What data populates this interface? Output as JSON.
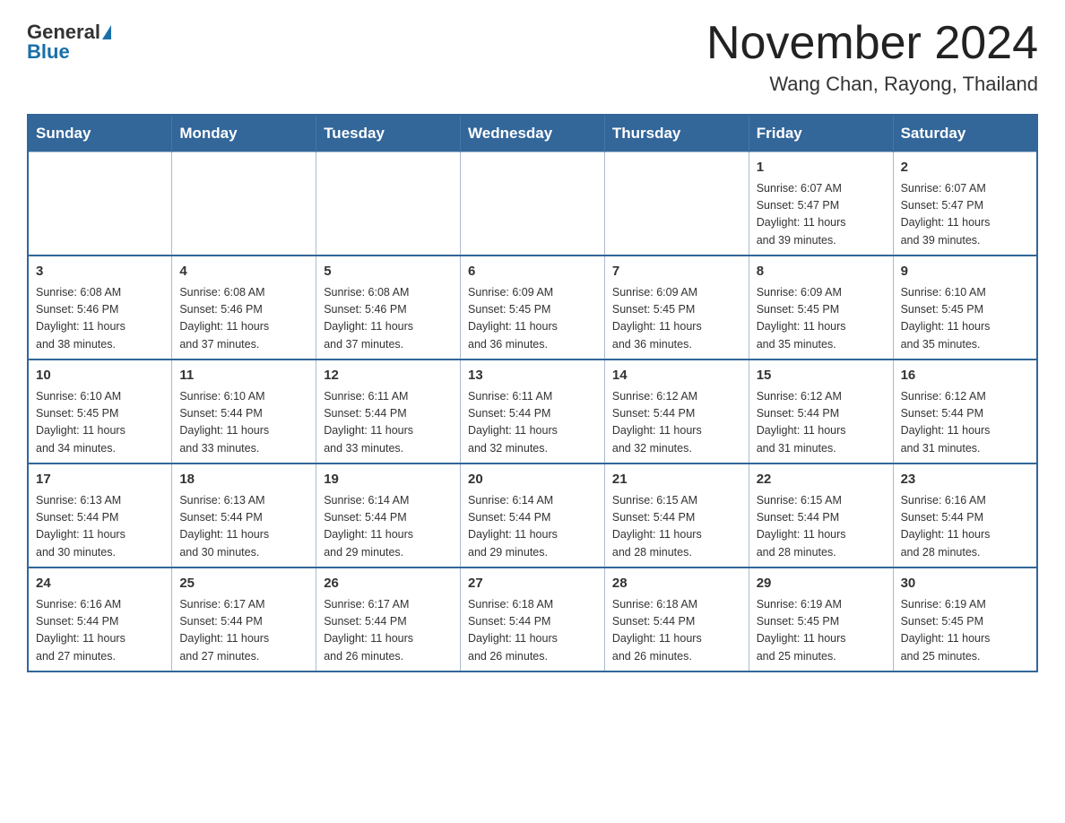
{
  "logo": {
    "general": "General",
    "blue": "Blue",
    "triangle": "▶"
  },
  "title": {
    "month_year": "November 2024",
    "location": "Wang Chan, Rayong, Thailand"
  },
  "calendar": {
    "headers": [
      "Sunday",
      "Monday",
      "Tuesday",
      "Wednesday",
      "Thursday",
      "Friday",
      "Saturday"
    ],
    "weeks": [
      [
        {
          "day": "",
          "info": ""
        },
        {
          "day": "",
          "info": ""
        },
        {
          "day": "",
          "info": ""
        },
        {
          "day": "",
          "info": ""
        },
        {
          "day": "",
          "info": ""
        },
        {
          "day": "1",
          "info": "Sunrise: 6:07 AM\nSunset: 5:47 PM\nDaylight: 11 hours\nand 39 minutes."
        },
        {
          "day": "2",
          "info": "Sunrise: 6:07 AM\nSunset: 5:47 PM\nDaylight: 11 hours\nand 39 minutes."
        }
      ],
      [
        {
          "day": "3",
          "info": "Sunrise: 6:08 AM\nSunset: 5:46 PM\nDaylight: 11 hours\nand 38 minutes."
        },
        {
          "day": "4",
          "info": "Sunrise: 6:08 AM\nSunset: 5:46 PM\nDaylight: 11 hours\nand 37 minutes."
        },
        {
          "day": "5",
          "info": "Sunrise: 6:08 AM\nSunset: 5:46 PM\nDaylight: 11 hours\nand 37 minutes."
        },
        {
          "day": "6",
          "info": "Sunrise: 6:09 AM\nSunset: 5:45 PM\nDaylight: 11 hours\nand 36 minutes."
        },
        {
          "day": "7",
          "info": "Sunrise: 6:09 AM\nSunset: 5:45 PM\nDaylight: 11 hours\nand 36 minutes."
        },
        {
          "day": "8",
          "info": "Sunrise: 6:09 AM\nSunset: 5:45 PM\nDaylight: 11 hours\nand 35 minutes."
        },
        {
          "day": "9",
          "info": "Sunrise: 6:10 AM\nSunset: 5:45 PM\nDaylight: 11 hours\nand 35 minutes."
        }
      ],
      [
        {
          "day": "10",
          "info": "Sunrise: 6:10 AM\nSunset: 5:45 PM\nDaylight: 11 hours\nand 34 minutes."
        },
        {
          "day": "11",
          "info": "Sunrise: 6:10 AM\nSunset: 5:44 PM\nDaylight: 11 hours\nand 33 minutes."
        },
        {
          "day": "12",
          "info": "Sunrise: 6:11 AM\nSunset: 5:44 PM\nDaylight: 11 hours\nand 33 minutes."
        },
        {
          "day": "13",
          "info": "Sunrise: 6:11 AM\nSunset: 5:44 PM\nDaylight: 11 hours\nand 32 minutes."
        },
        {
          "day": "14",
          "info": "Sunrise: 6:12 AM\nSunset: 5:44 PM\nDaylight: 11 hours\nand 32 minutes."
        },
        {
          "day": "15",
          "info": "Sunrise: 6:12 AM\nSunset: 5:44 PM\nDaylight: 11 hours\nand 31 minutes."
        },
        {
          "day": "16",
          "info": "Sunrise: 6:12 AM\nSunset: 5:44 PM\nDaylight: 11 hours\nand 31 minutes."
        }
      ],
      [
        {
          "day": "17",
          "info": "Sunrise: 6:13 AM\nSunset: 5:44 PM\nDaylight: 11 hours\nand 30 minutes."
        },
        {
          "day": "18",
          "info": "Sunrise: 6:13 AM\nSunset: 5:44 PM\nDaylight: 11 hours\nand 30 minutes."
        },
        {
          "day": "19",
          "info": "Sunrise: 6:14 AM\nSunset: 5:44 PM\nDaylight: 11 hours\nand 29 minutes."
        },
        {
          "day": "20",
          "info": "Sunrise: 6:14 AM\nSunset: 5:44 PM\nDaylight: 11 hours\nand 29 minutes."
        },
        {
          "day": "21",
          "info": "Sunrise: 6:15 AM\nSunset: 5:44 PM\nDaylight: 11 hours\nand 28 minutes."
        },
        {
          "day": "22",
          "info": "Sunrise: 6:15 AM\nSunset: 5:44 PM\nDaylight: 11 hours\nand 28 minutes."
        },
        {
          "day": "23",
          "info": "Sunrise: 6:16 AM\nSunset: 5:44 PM\nDaylight: 11 hours\nand 28 minutes."
        }
      ],
      [
        {
          "day": "24",
          "info": "Sunrise: 6:16 AM\nSunset: 5:44 PM\nDaylight: 11 hours\nand 27 minutes."
        },
        {
          "day": "25",
          "info": "Sunrise: 6:17 AM\nSunset: 5:44 PM\nDaylight: 11 hours\nand 27 minutes."
        },
        {
          "day": "26",
          "info": "Sunrise: 6:17 AM\nSunset: 5:44 PM\nDaylight: 11 hours\nand 26 minutes."
        },
        {
          "day": "27",
          "info": "Sunrise: 6:18 AM\nSunset: 5:44 PM\nDaylight: 11 hours\nand 26 minutes."
        },
        {
          "day": "28",
          "info": "Sunrise: 6:18 AM\nSunset: 5:44 PM\nDaylight: 11 hours\nand 26 minutes."
        },
        {
          "day": "29",
          "info": "Sunrise: 6:19 AM\nSunset: 5:45 PM\nDaylight: 11 hours\nand 25 minutes."
        },
        {
          "day": "30",
          "info": "Sunrise: 6:19 AM\nSunset: 5:45 PM\nDaylight: 11 hours\nand 25 minutes."
        }
      ]
    ]
  }
}
